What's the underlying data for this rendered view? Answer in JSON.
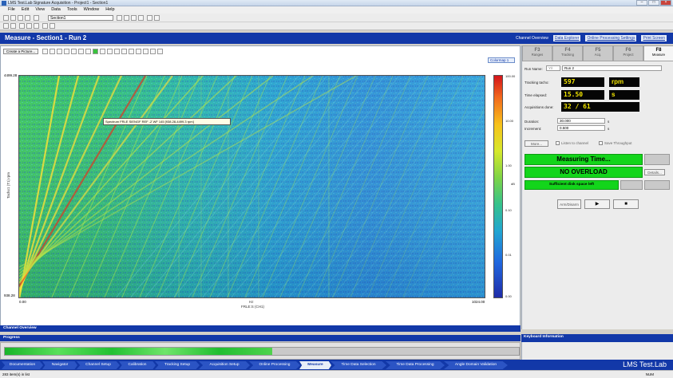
{
  "window": {
    "title": "LMS Test.Lab Signature Acquisition - Project1 - Section1",
    "buttons": [
      "–",
      "□",
      "×"
    ]
  },
  "menu": [
    "File",
    "Edit",
    "View",
    "Data",
    "Tools",
    "Window",
    "Help"
  ],
  "toolbar": {
    "section_select": "Section1"
  },
  "header": {
    "breadcrumb": "Measure   -   Section1   -   Run 2",
    "links": [
      "Channel Overview",
      "Data Explorer",
      "Online Processing Settings",
      "Print Screen"
    ]
  },
  "left_panel": {
    "create_picture_label": "Create a Picture...",
    "colormap_tab": "Colormap 1",
    "tooltip": "Spectrum FRLE SIENGF REF -Z WF 145 [938.28-4499.3 rpm]",
    "y_axis_label": "Tacho1 (T1) rpm",
    "y_ticks": [
      "4499.28",
      "938.28"
    ],
    "x_axis_label": "Hz",
    "x_axis_sub": "FRLE:S (CH1)",
    "x_ticks": [
      "0.00",
      "1024.00"
    ],
    "colorbar_ticks": [
      "100.00",
      "10.00",
      "1.00",
      "0.10",
      "0.01",
      "0.00"
    ],
    "colorbar_unit": "dB",
    "channel_overview_label": "Channel Overview",
    "progress_label": "Progress",
    "progress_fraction": 0.52
  },
  "right_panel": {
    "tabs": [
      {
        "key": "F3",
        "label": "Ranges"
      },
      {
        "key": "F4",
        "label": "Tracking"
      },
      {
        "key": "F5",
        "label": "Acq."
      },
      {
        "key": "F6",
        "label": "Project"
      },
      {
        "key": "F8",
        "label": "Measure"
      }
    ],
    "run_name_label": "Run Name:",
    "run_prefix": "Y/I",
    "run_name": "Run 2",
    "tracking_tacho_label": "Tracking tacho:",
    "tracking_tacho_value": "597",
    "tracking_tacho_unit": "rpm",
    "time_elapsed_label": "Time elapsed:",
    "time_elapsed_value": "15.50",
    "time_elapsed_unit": "s",
    "acq_done_label": "Acquisitions done:",
    "acq_done_value": "32 / 61",
    "duration_label": "Duration:",
    "duration_value": "30.000",
    "duration_unit": "s",
    "increment_label": "Increment:",
    "increment_value": "0.500",
    "increment_unit": "s",
    "more_button": "More...",
    "listen_label": "Listen to channel",
    "save_throughput_label": "Save Throughput",
    "measuring_status": "Measuring Time...",
    "overload_status": "NO OVERLOAD",
    "details_button": "Details...",
    "disk_status": "Sufficient disk space left",
    "arm_button": "Arm/Disarm",
    "keyboard_info_label": "Keyboard Information"
  },
  "workflow": {
    "tabs": [
      "Documentation",
      "Navigator",
      "Channel Setup",
      "Calibration",
      "Tracking Setup",
      "Acquisition Setup",
      "Online Processing",
      "Measure",
      "Time Data Selection",
      "Time Data Processing",
      "Angle Domain Validation"
    ],
    "active": "Measure",
    "brand": "LMS Test.Lab"
  },
  "status": {
    "left": "283 item(s) in list",
    "right": "NUM"
  }
}
